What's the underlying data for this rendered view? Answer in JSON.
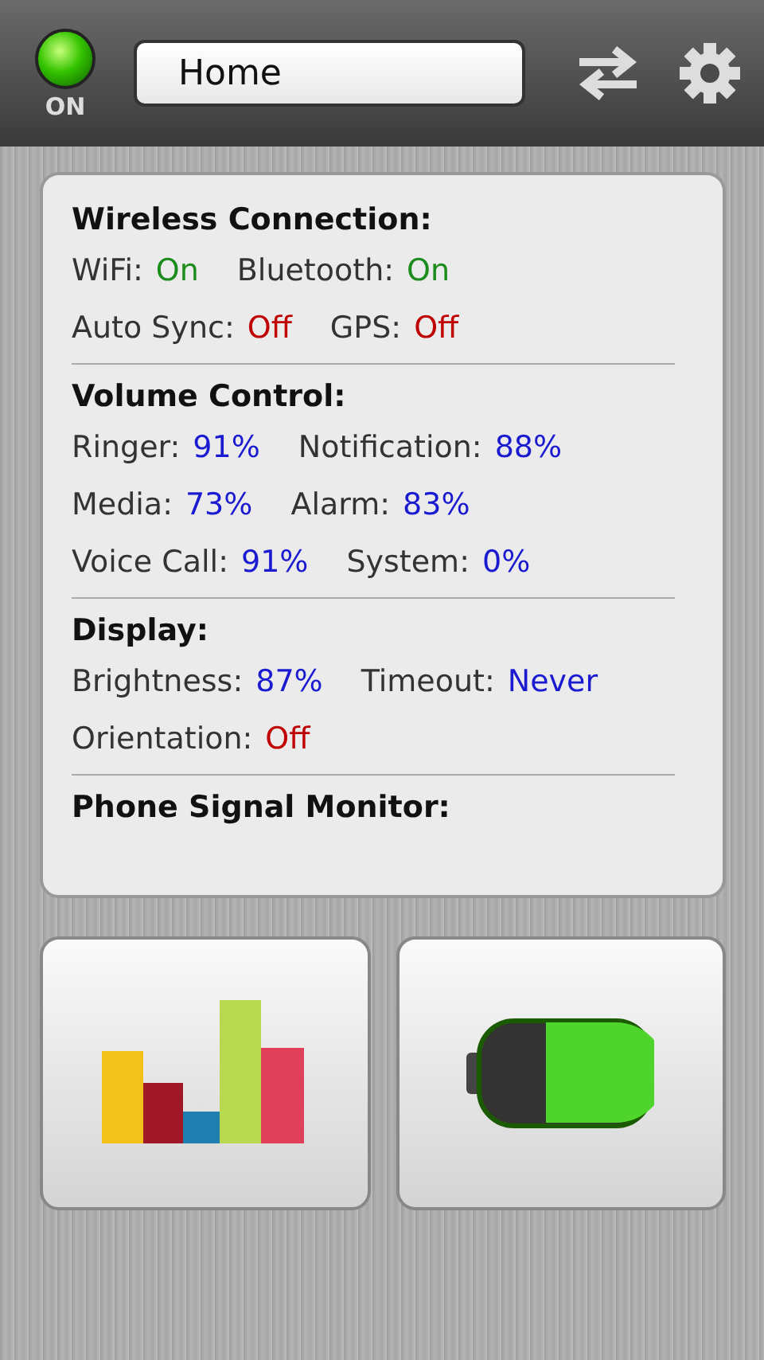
{
  "status": {
    "label": "ON",
    "on": true
  },
  "profile": {
    "value": "Home"
  },
  "sections": [
    {
      "title": "Wireless Connection:",
      "rows": [
        [
          {
            "label": "WiFi:",
            "value": "On",
            "kind": "on"
          },
          {
            "label": "Bluetooth:",
            "value": "On",
            "kind": "on"
          }
        ],
        [
          {
            "label": "Auto Sync:",
            "value": "Off",
            "kind": "off"
          },
          {
            "label": "GPS:",
            "value": "Off",
            "kind": "off"
          }
        ]
      ]
    },
    {
      "title": "Volume Control:",
      "rows": [
        [
          {
            "label": "Ringer:",
            "value": "91%",
            "kind": "level"
          },
          {
            "label": "Notification:",
            "value": "88%",
            "kind": "level"
          }
        ],
        [
          {
            "label": "Media:",
            "value": "73%",
            "kind": "level"
          },
          {
            "label": "Alarm:",
            "value": "83%",
            "kind": "level"
          }
        ],
        [
          {
            "label": "Voice Call:",
            "value": "91%",
            "kind": "level"
          },
          {
            "label": "System:",
            "value": "0%",
            "kind": "level"
          }
        ]
      ]
    },
    {
      "title": "Display:",
      "rows": [
        [
          {
            "label": "Brightness:",
            "value": "87%",
            "kind": "level"
          },
          {
            "label": "Timeout:",
            "value": "Never",
            "kind": "level"
          }
        ],
        [
          {
            "label": "Orientation:",
            "value": "Off",
            "kind": "off"
          }
        ]
      ]
    },
    {
      "title": "Phone Signal Monitor:"
    }
  ],
  "tiles": [
    {
      "kind": "chart"
    },
    {
      "kind": "battery"
    }
  ]
}
